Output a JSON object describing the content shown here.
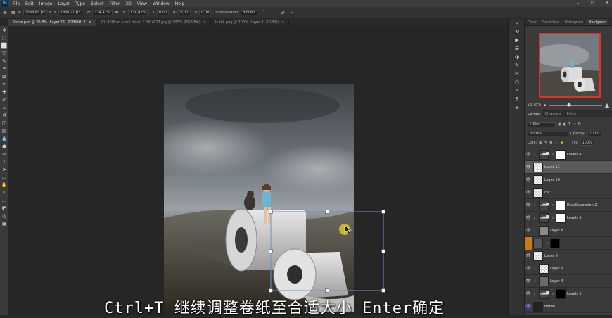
{
  "menu": [
    "File",
    "Edit",
    "Image",
    "Layer",
    "Type",
    "Select",
    "Filter",
    "3D",
    "View",
    "Window",
    "Help"
  ],
  "app_icon": "Ps",
  "options": {
    "x_label": "X:",
    "x_value": "2536,69 px",
    "y_label": "Y:",
    "y_value": "2938,21 px",
    "w_label": "W:",
    "w_value": "134,42%",
    "h_label": "H:",
    "h_value": "134,42%",
    "angle_label": "∠",
    "angle_value": "0,00",
    "hskew_label": "H:",
    "hskew_value": "0,00",
    "vskew_label": "V:",
    "vskew_value": "0,00",
    "interp_label": "Interpolation:",
    "interp_value": "Bicubic"
  },
  "tabs": [
    {
      "label": "Stone.psd @ 20,8% (Layer 11, RGB/8#) *",
      "active": true
    },
    {
      "label": "2018 08 on a roll detail 1280x827.jpg @ 100% (RGB/8#)",
      "active": false
    },
    {
      "label": "ls roll.png @ 100% (Layer 1, RGB/8)",
      "active": false
    }
  ],
  "subtitle": "Ctrl+T 继续调整卷纸至合适大小 Enter确定",
  "panel": {
    "tabs": [
      "Color",
      "Swatches",
      "Histogram",
      "Navigator"
    ],
    "zoom": "20,78%",
    "layer_tabs": [
      "Layers",
      "Channels",
      "Paths"
    ],
    "kind_label": "Kind",
    "blend_mode": "Normal",
    "opacity_label": "Opacity:",
    "opacity_value": "100%",
    "lock_label": "Lock:",
    "fill_label": "Fill:",
    "fill_value": "100%"
  },
  "layers": [
    {
      "name": "Levels 4",
      "type": "adj"
    },
    {
      "name": "Layer 11",
      "type": "pix",
      "selected": true
    },
    {
      "name": "Layer 10",
      "type": "pix"
    },
    {
      "name": "cat",
      "type": "pix"
    },
    {
      "name": "Hue/Saturation 2",
      "type": "adj"
    },
    {
      "name": "Levels 5",
      "type": "adj"
    },
    {
      "name": "Layer 8",
      "type": "gray"
    },
    {
      "name": "",
      "type": "maskblack"
    },
    {
      "name": "Layer 6",
      "type": "pix"
    },
    {
      "name": "Layer 9",
      "type": "pix"
    },
    {
      "name": "Layer 4",
      "type": "gray"
    },
    {
      "name": "Levels 2",
      "type": "adj"
    },
    {
      "name": "Bitton",
      "type": "dark"
    }
  ]
}
